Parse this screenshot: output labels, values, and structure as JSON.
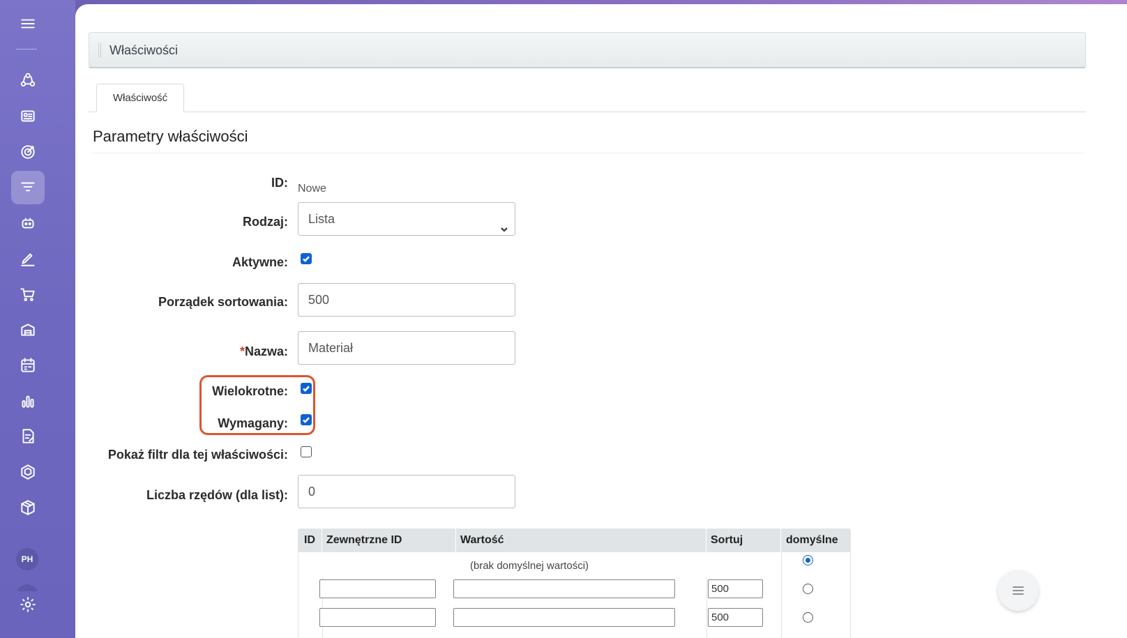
{
  "header": {
    "title": "Właściwości"
  },
  "tabs": [
    {
      "label": "Właściwość"
    }
  ],
  "section": {
    "title": "Parametry właściwości"
  },
  "form": {
    "id": {
      "label": "ID:",
      "value": "Nowe"
    },
    "type": {
      "label": "Rodzaj:",
      "value": "Lista"
    },
    "active": {
      "label": "Aktywne:",
      "checked": true
    },
    "sort": {
      "label": "Porządek sortowania:",
      "value": "500"
    },
    "name": {
      "required_mark": "*",
      "label": "Nazwa:",
      "value": "Materiał"
    },
    "multiple": {
      "label": "Wielokrotne:",
      "checked": true
    },
    "required": {
      "label": "Wymagany:",
      "checked": true
    },
    "show_filter": {
      "label": "Pokaż filtr dla tej właściwości:",
      "checked": false
    },
    "rows": {
      "label": "Liczba rzędów (dla list):",
      "value": "0"
    }
  },
  "table": {
    "headers": [
      "ID",
      "Zewnętrzne ID",
      "Wartość",
      "Sortuj",
      "domyślne"
    ],
    "no_default_label": "(brak domyślnej wartości)",
    "rows": [
      {
        "id": "",
        "external_id": "",
        "value": "",
        "sort": "500",
        "default": false
      },
      {
        "id": "",
        "external_id": "",
        "value": "",
        "sort": "500",
        "default": false
      }
    ]
  },
  "sidebar": {
    "items": [
      "menu-icon",
      "integrations-icon",
      "contact-center-icon",
      "goals-icon",
      "crm-funnel-icon",
      "copilot-icon",
      "sign-icon",
      "shop-icon",
      "inventory-icon",
      "booking-icon",
      "analytics-icon",
      "documents-icon",
      "automation-icon",
      "catalog-icon",
      "settings-icon"
    ],
    "avatar_initials": "PH"
  },
  "colors": {
    "accent": "#0f62d4",
    "highlight": "#e0532d",
    "sidebar": "#7b74c9"
  }
}
